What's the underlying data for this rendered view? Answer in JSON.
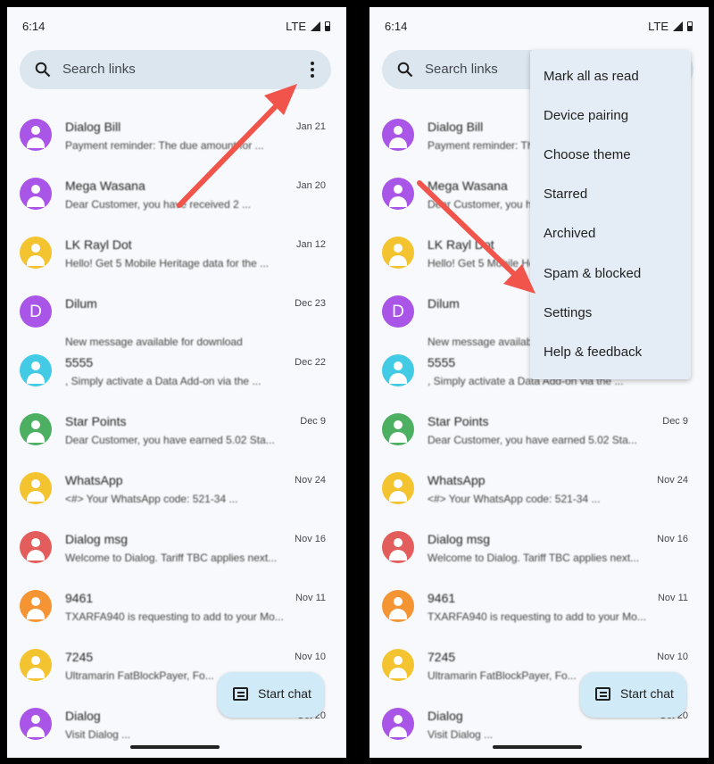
{
  "status": {
    "time": "6:14",
    "network": "LTE"
  },
  "search": {
    "placeholder": "Search links"
  },
  "conversations": [
    {
      "name": "Dialog Bill",
      "date": "Jan 21",
      "preview": "Payment reminder: The due amount for ...",
      "color": "#a855e8",
      "avatar": "person-icon"
    },
    {
      "name": "Mega Wasana",
      "date": "Jan 20",
      "preview": "Dear Customer, you have received 2 ...",
      "color": "#a855e8",
      "avatar": "person-icon"
    },
    {
      "name": "LK Rayl Dot",
      "date": "Jan 12",
      "preview": "Hello! Get 5 Mobile Heritage data for the ...",
      "color": "#f4c430",
      "avatar": "person-icon"
    },
    {
      "name": "Dilum",
      "date": "Dec 23",
      "preview": "New message available for download",
      "color": "#a855e8",
      "avatar": "D"
    },
    {
      "name": "5555",
      "date": "Dec 22",
      "preview": ", Simply activate a Data Add-on via the ...",
      "color": "#43cbe6",
      "avatar": "person-icon"
    },
    {
      "name": "Star Points",
      "date": "Dec 9",
      "preview": "Dear Customer, you have earned 5.02 Sta...",
      "color": "#4caf62",
      "avatar": "person-icon"
    },
    {
      "name": "WhatsApp",
      "date": "Nov 24",
      "preview": "<#> Your WhatsApp code: 521-34 ...",
      "color": "#f4c430",
      "avatar": "person-icon"
    },
    {
      "name": "Dialog msg",
      "date": "Nov 16",
      "preview": "Welcome to Dialog. Tariff TBC applies next...",
      "color": "#e35d5d",
      "avatar": "person-icon"
    },
    {
      "name": "9461",
      "date": "Nov 11",
      "preview": "TXARFA940 is requesting to add to your Mo...",
      "color": "#f49433",
      "avatar": "person-icon"
    },
    {
      "name": "7245",
      "date": "Nov 10",
      "preview": "Ultramarin FatBlockPayer, Fo...",
      "color": "#f4c430",
      "avatar": "person-icon"
    },
    {
      "name": "Dialog",
      "date": "Oct 20",
      "preview": "Visit Dialog ...",
      "color": "#a855e8",
      "avatar": "person-icon"
    }
  ],
  "fab": {
    "label": "Start chat"
  },
  "menu": {
    "items": [
      "Mark all as read",
      "Device pairing",
      "Choose theme",
      "Starred",
      "Archived",
      "Spam & blocked",
      "Settings",
      "Help & feedback"
    ]
  },
  "colors": {
    "arrow": "#f0544a",
    "search_bg": "#dce6ee",
    "fab_bg": "#d0eaf7",
    "menu_bg": "#e4edf5"
  }
}
